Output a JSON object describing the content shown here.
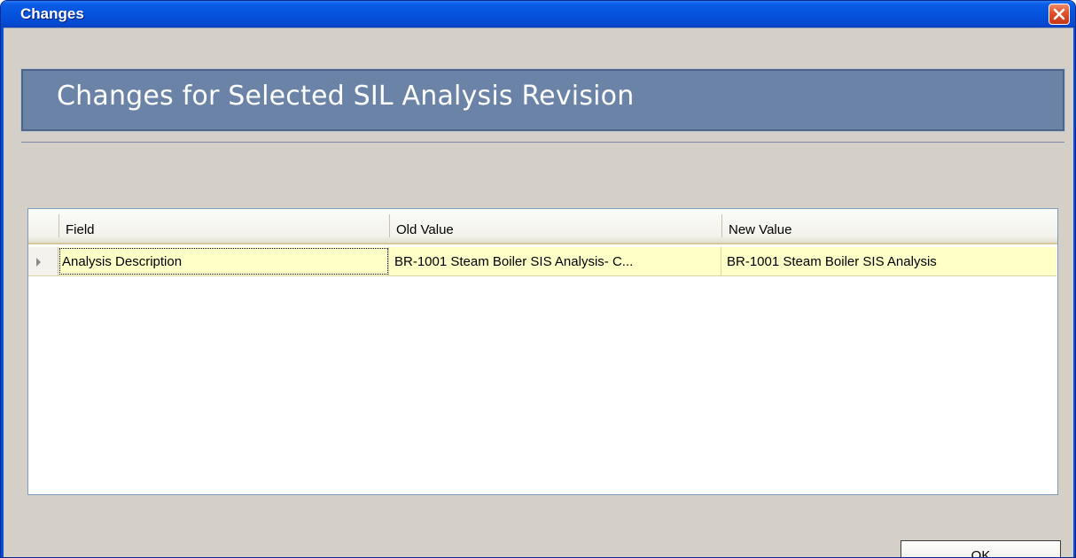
{
  "window": {
    "title": "Changes",
    "close_icon": "close-x-icon"
  },
  "banner": {
    "title": "Changes for Selected SIL Analysis Revision"
  },
  "grid": {
    "columns": [
      "Field",
      "Old Value",
      "New Value"
    ],
    "rows": [
      {
        "field": "Analysis Description",
        "old_value": "BR-1001 Steam Boiler SIS Analysis- C...",
        "new_value": "BR-1001 Steam Boiler SIS Analysis",
        "indicator_icon": "row-pointer-icon"
      }
    ]
  },
  "buttons": {
    "ok_label": "OK"
  },
  "colors": {
    "titlebar": "#0553dd",
    "banner": "#6a83a6",
    "selected_row": "#ffffc8",
    "dialog_face": "#d4d0c8"
  }
}
